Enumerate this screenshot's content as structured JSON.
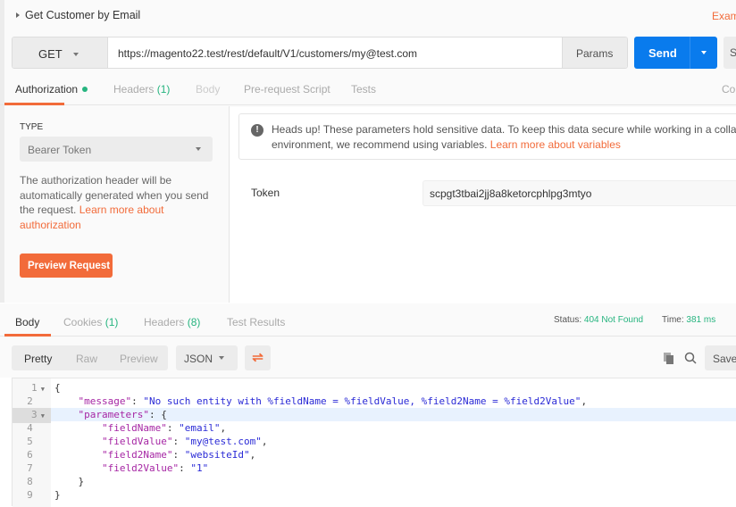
{
  "request": {
    "title": "Get Customer by Email",
    "examples_label": "Exam",
    "method": "GET",
    "url": "https://magento22.test/rest/default/V1/customers/my@test.com",
    "params_label": "Params",
    "send_label": "Send",
    "save_label": "S"
  },
  "request_tabs": [
    {
      "label": "Authorization",
      "count": ""
    },
    {
      "label": "Headers",
      "count": "(1)"
    },
    {
      "label": "Body",
      "count": ""
    },
    {
      "label": "Pre-request Script",
      "count": ""
    },
    {
      "label": "Tests",
      "count": ""
    }
  ],
  "code_link": "Co",
  "auth": {
    "type_label": "TYPE",
    "type_value": "Bearer Token",
    "description": "The authorization header will be automatically generated when you send the request. ",
    "learn_more": "Learn more about authorization",
    "preview_button": "Preview Request",
    "warning_text": "Heads up! These parameters hold sensitive data. To keep this data secure while working in a collabora",
    "warning_text2": "environment, we recommend using variables. ",
    "warning_link": "Learn more about variables",
    "token_label": "Token",
    "token_value": "scpgt3tbai2jj8a8ketorcphlpg3mtyo"
  },
  "response_tabs": [
    {
      "label": "Body",
      "count": ""
    },
    {
      "label": "Cookies",
      "count": "(1)"
    },
    {
      "label": "Headers",
      "count": "(8)"
    },
    {
      "label": "Test Results",
      "count": ""
    }
  ],
  "response_status": {
    "status_label": "Status:",
    "status_value": "404 Not Found",
    "time_label": "Time:",
    "time_value": "381 ms"
  },
  "response_toolbar": {
    "views": [
      "Pretty",
      "Raw",
      "Preview"
    ],
    "format": "JSON",
    "save_label": "Save"
  },
  "colors": {
    "accent": "#f26b3a",
    "send": "#097bed",
    "success": "#26b47f",
    "json_key": "#a626a4",
    "json_string": "#2a2ad6"
  },
  "response_body": [
    {
      "n": "1",
      "fold": true,
      "indent": 0,
      "parts": [
        [
          "p",
          "{"
        ]
      ]
    },
    {
      "n": "2",
      "indent": 1,
      "parts": [
        [
          "k",
          "\"message\""
        ],
        [
          "p",
          ": "
        ],
        [
          "s",
          "\"No such entity with %fieldName = %fieldValue, %field2Name = %field2Value\""
        ],
        [
          "p",
          ","
        ]
      ]
    },
    {
      "n": "3",
      "fold": true,
      "hl": true,
      "indent": 1,
      "parts": [
        [
          "k",
          "\"parameters\""
        ],
        [
          "p",
          ": {"
        ]
      ]
    },
    {
      "n": "4",
      "indent": 2,
      "parts": [
        [
          "k",
          "\"fieldName\""
        ],
        [
          "p",
          ": "
        ],
        [
          "s",
          "\"email\""
        ],
        [
          "p",
          ","
        ]
      ]
    },
    {
      "n": "5",
      "indent": 2,
      "parts": [
        [
          "k",
          "\"fieldValue\""
        ],
        [
          "p",
          ": "
        ],
        [
          "s",
          "\"my@test.com\""
        ],
        [
          "p",
          ","
        ]
      ]
    },
    {
      "n": "6",
      "indent": 2,
      "parts": [
        [
          "k",
          "\"field2Name\""
        ],
        [
          "p",
          ": "
        ],
        [
          "s",
          "\"websiteId\""
        ],
        [
          "p",
          ","
        ]
      ]
    },
    {
      "n": "7",
      "indent": 2,
      "parts": [
        [
          "k",
          "\"field2Value\""
        ],
        [
          "p",
          ": "
        ],
        [
          "s",
          "\"1\""
        ]
      ]
    },
    {
      "n": "8",
      "indent": 1,
      "parts": [
        [
          "p",
          "}"
        ]
      ]
    },
    {
      "n": "9",
      "indent": 0,
      "parts": [
        [
          "p",
          "}"
        ]
      ]
    }
  ]
}
